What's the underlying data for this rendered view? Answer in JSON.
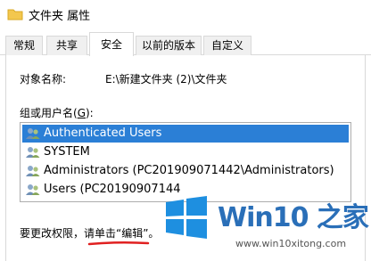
{
  "window": {
    "title": "文件夹 属性"
  },
  "tabs": [
    {
      "label": "常规"
    },
    {
      "label": "共享"
    },
    {
      "label": "安全"
    },
    {
      "label": "以前的版本"
    },
    {
      "label": "自定义"
    }
  ],
  "object": {
    "label": "对象名称:",
    "value": "E:\\新建文件夹 (2)\\文件夹"
  },
  "groups": {
    "label_pre": "组或用户名(",
    "label_key": "G",
    "label_post": "):",
    "items": [
      {
        "name": "Authenticated Users"
      },
      {
        "name": "SYSTEM"
      },
      {
        "name": "Administrators (PC201909071442\\Administrators)"
      },
      {
        "name": "Users (PC20190907144"
      }
    ]
  },
  "footer": {
    "note": "要更改权限，请单击“编辑”。"
  },
  "watermark": {
    "name": "Win10 之家",
    "url": "www.win10xitong.com"
  },
  "colors": {
    "selection": "#2b7fd6",
    "brand": "#2a6fb8",
    "annotation": "#e02020"
  }
}
